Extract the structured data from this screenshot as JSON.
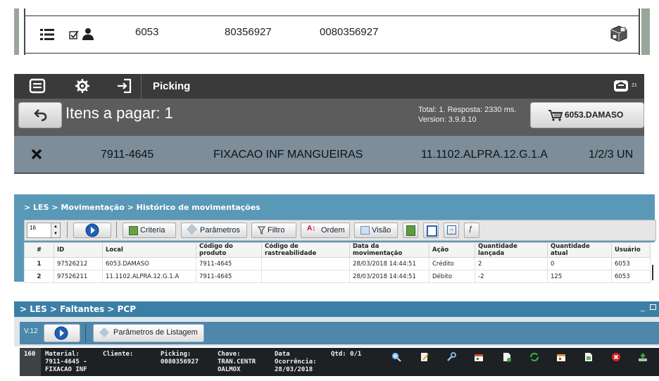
{
  "panel1": {
    "operator": "6053",
    "code1": "80356927",
    "code2": "0080356927",
    "icons": [
      "list-icon",
      "checkbox-icon",
      "user-icon",
      "boxes-icon"
    ]
  },
  "panel2": {
    "title": "Picking",
    "heading": "Itens a pagar: 1",
    "meta_line1": "Total: 1. Resposta: 2330 ms.",
    "meta_line2": "Version: 3.9.8.10",
    "cart_label": "6053.DAMASO",
    "notif_count": "21",
    "item": {
      "id": "7911-4645",
      "desc": "FIXACAO INF MANGUEIRAS",
      "local": "11.1102.ALPRA.12.G.1.A",
      "qty": "1/2/3 UN"
    }
  },
  "panel3": {
    "breadcrumb": "> LES > Movimentação > Histórico de movimentações",
    "page_size": "16",
    "buttons": {
      "criteria": "Criteria",
      "params": "Parâmetros",
      "filtro": "Filtro",
      "ordem": "Ordem",
      "visao": "Visão"
    },
    "columns": [
      "#",
      "ID",
      "Local",
      "Código do produto",
      "Código de rastreabilidade",
      "Data da movimentação",
      "Ação",
      "Quantidade lançada",
      "Quantidade atual",
      "Usuário"
    ],
    "rows": [
      [
        "1",
        "97526212",
        "6053.DAMASO",
        "7911-4645",
        "",
        "28/03/2018 14:44:51",
        "Crédito",
        "2",
        "0",
        "6053"
      ],
      [
        "2",
        "97526211",
        "11.1102.ALPRA.12.G.1.A",
        "7911-4645",
        "",
        "28/03/2018 14:44:51",
        "Débito",
        "-2",
        "125",
        "6053"
      ]
    ]
  },
  "panel4": {
    "breadcrumb": "> LES > Faltantes > PCP",
    "version": "V.12",
    "param_label": "Parâmetros de Listagem",
    "row": {
      "index": "160",
      "material_label": "Material:",
      "material_value1": "7911-4645 -",
      "material_value2": "FIXACAO INF",
      "cliente_label": "Cliente:",
      "picking_label": "Picking:",
      "picking_value": "0080356927",
      "chave_label": "Chave:",
      "chave_value1": "TRAN.CENTR",
      "chave_value2": "OALMOX",
      "data_label": "Data",
      "ocorrencia_label": "Ocorrência:",
      "data_value": "28/03/2018",
      "qtd": "Qtd: 0/1"
    }
  }
}
